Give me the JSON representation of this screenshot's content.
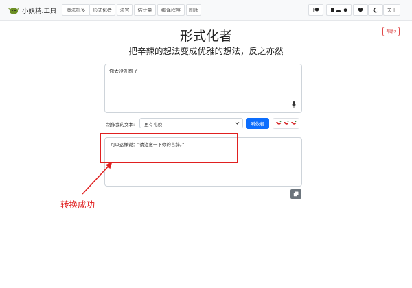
{
  "navbar": {
    "brand": "小妖精.工具",
    "tabs": [
      "魔法托多",
      "形式化者",
      "法官",
      "估计量",
      "编译程序",
      "图师"
    ],
    "about": "关于"
  },
  "page": {
    "title": "形式化者",
    "subtitle": "把辛辣的想法变成优雅的想法，反之亦然",
    "help": "帮助?"
  },
  "input": {
    "value": "你太没礼貌了"
  },
  "controls": {
    "label": "制作我的文本:",
    "selected_option": "更有礼貌",
    "transform_button": "嗬依者"
  },
  "output": {
    "value": "可以这样说：“请注意一下你的言辞。”"
  },
  "annotation": {
    "text": "转换成功",
    "color": "#e02020"
  },
  "colors": {
    "primary": "#0d6efd",
    "annotation": "#e02020",
    "copy_button": "#6c757d"
  }
}
